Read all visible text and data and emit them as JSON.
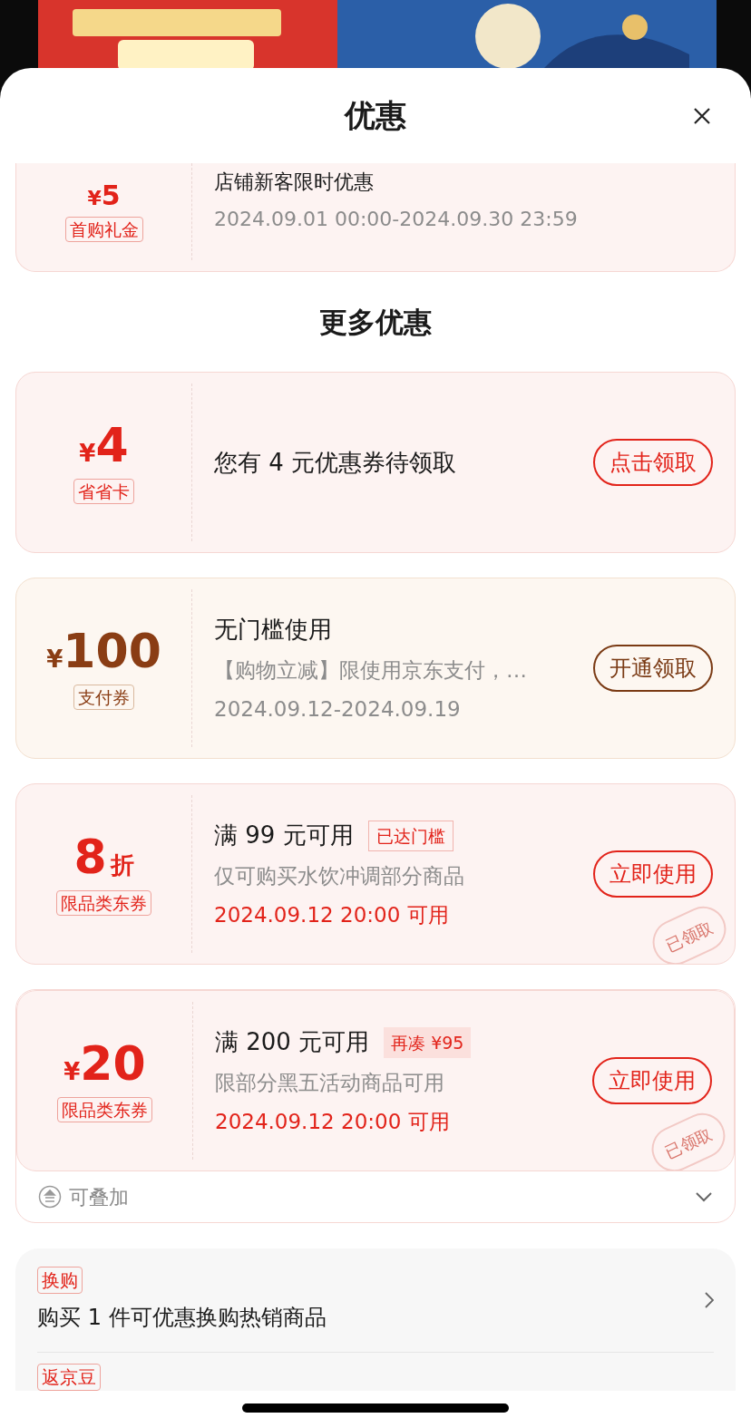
{
  "sheet": {
    "title": "优惠"
  },
  "first_coupon": {
    "currency": "¥",
    "amount": "5",
    "tag": "首购礼金",
    "title": "店铺新客限时优惠",
    "date": "2024.09.01 00:00-2024.09.30 23:59"
  },
  "section_title": "更多优惠",
  "coupons": [
    {
      "kind": "red",
      "currency": "¥",
      "amount": "4",
      "tag": "省省卡",
      "title": "您有 4 元优惠券待领取",
      "button": "点击领取"
    },
    {
      "kind": "gold",
      "currency": "¥",
      "amount": "100",
      "tag": "支付券",
      "title": "无门槛使用",
      "desc": "【购物立减】限使用京东支付，…",
      "date": "2024.09.12-2024.09.19",
      "date_highlight": false,
      "button": "开通领取"
    },
    {
      "kind": "red",
      "amount": "8",
      "unit": "折",
      "tag": "限品类东券",
      "title": "满 99 元可用",
      "badge": {
        "text": "已达门槛",
        "kind": "outline"
      },
      "desc": "仅可购买水饮冲调部分商品",
      "date": "2024.09.12 20:00 可用",
      "date_highlight": true,
      "button": "立即使用",
      "stamp": "已领取"
    },
    {
      "kind": "red",
      "currency": "¥",
      "amount": "20",
      "tag": "限品类东券",
      "title": "满 200 元可用",
      "badge": {
        "text": "再凑 ¥95",
        "kind": "filled"
      },
      "desc": "限部分黑五活动商品可用",
      "date": "2024.09.12 20:00 可用",
      "date_highlight": true,
      "button": "立即使用",
      "stamp": "已领取"
    }
  ],
  "stack_note": {
    "label": "可叠加",
    "expanded": false
  },
  "offers": [
    {
      "tag": "换购",
      "text": "购买 1 件可优惠换购热销商品"
    },
    {
      "tag": "返京豆"
    }
  ]
}
